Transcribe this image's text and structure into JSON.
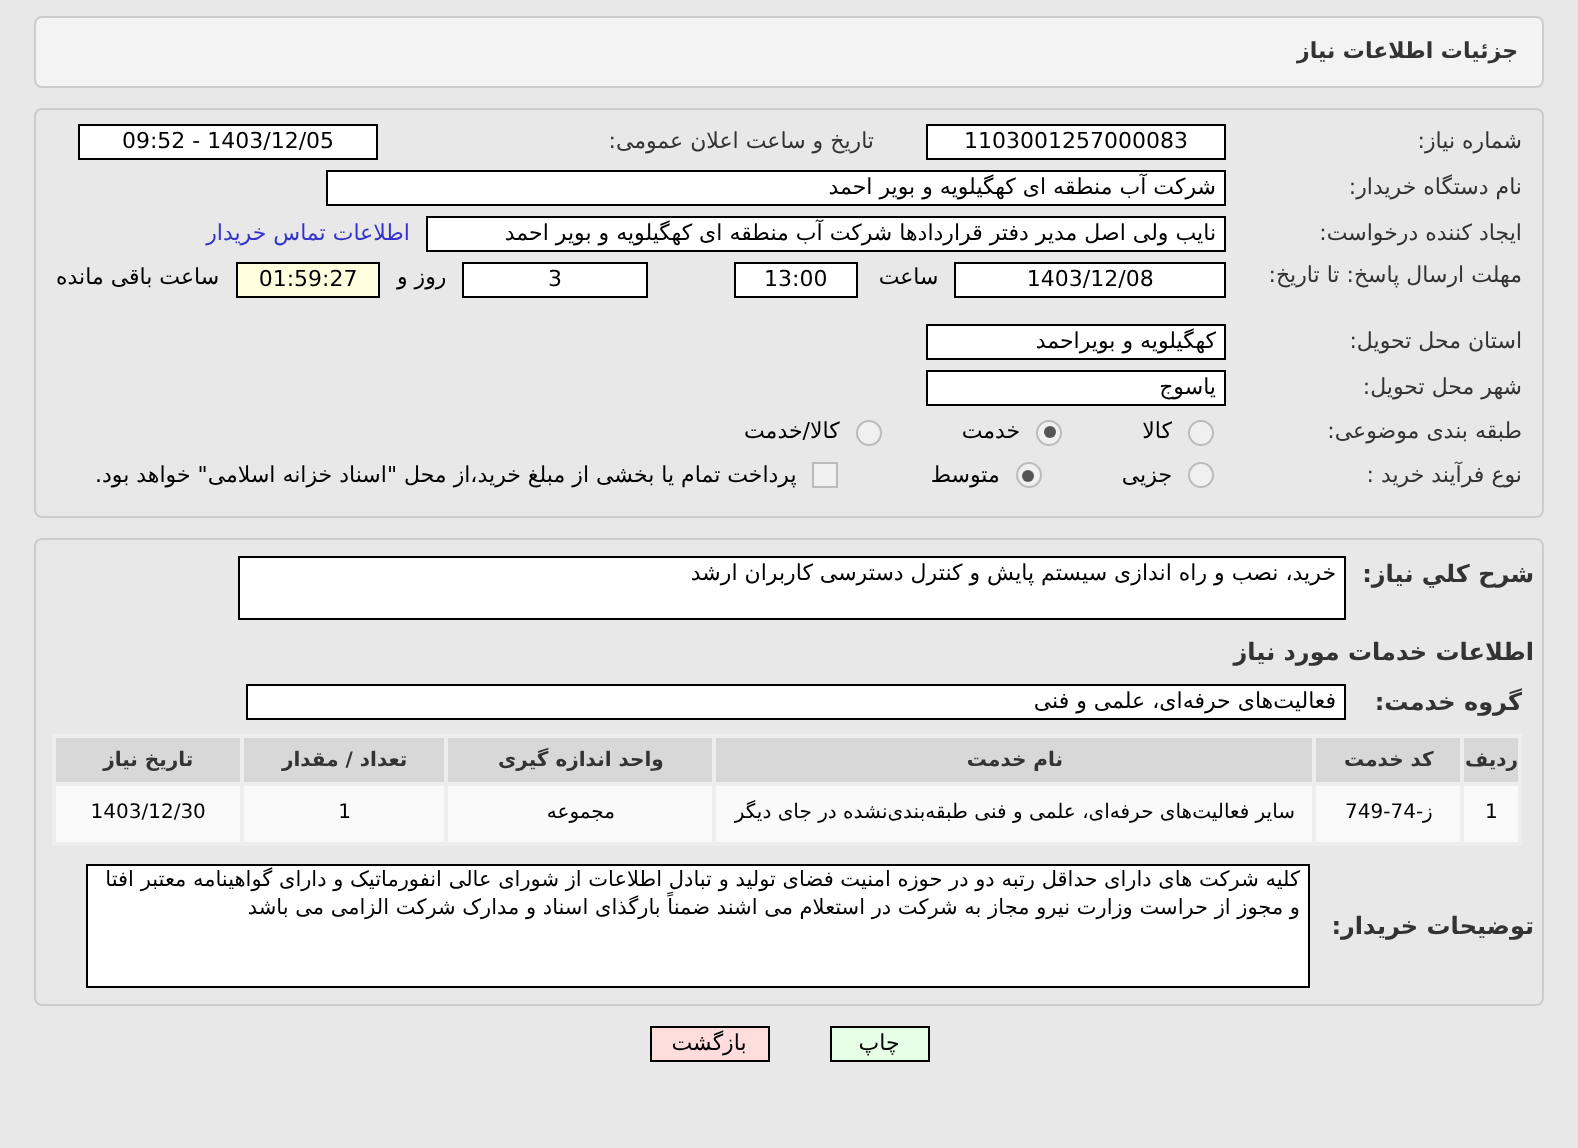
{
  "header": {
    "title": "جزئیات اطلاعات نیاز"
  },
  "need_number": {
    "label": "شماره نیاز:",
    "value": "1103001257000083"
  },
  "announce": {
    "label": "تاریخ و ساعت اعلان عمومی:",
    "value": "1403/12/05 - 09:52"
  },
  "buyer": {
    "label": "نام دستگاه خریدار:",
    "value": "شرکت آب منطقه ای کهگیلویه و بویر احمد"
  },
  "creator": {
    "label": "ایجاد کننده درخواست:",
    "value": "نایب ولی اصل مدیر دفتر قراردادها شرکت آب منطقه ای کهگیلویه و بویر احمد",
    "link": "اطلاعات تماس خریدار"
  },
  "deadline": {
    "label": "مهلت ارسال پاسخ: تا تاریخ:",
    "date": "1403/12/08",
    "time_label": "ساعت",
    "time": "13:00",
    "days": "3",
    "days_label": "روز و",
    "remaining": "01:59:27",
    "remaining_label": "ساعت باقی مانده"
  },
  "province": {
    "label": "استان محل تحویل:",
    "value": "کهگیلویه و بویراحمد"
  },
  "city": {
    "label": "شهر محل تحویل:",
    "value": "یاسوج"
  },
  "category": {
    "label": "طبقه بندی موضوعی:",
    "options": [
      {
        "label": "کالا",
        "selected": false
      },
      {
        "label": "خدمت",
        "selected": true
      },
      {
        "label": "کالا/خدمت",
        "selected": false
      }
    ]
  },
  "process": {
    "label": "نوع فرآیند خرید :",
    "options": [
      {
        "label": "جزیی",
        "selected": false
      },
      {
        "label": "متوسط",
        "selected": true
      }
    ],
    "treasury": {
      "checked": false,
      "label": "پرداخت تمام یا بخشی از مبلغ خرید،از محل \"اسناد خزانه اسلامی\" خواهد بود."
    }
  },
  "summary": {
    "label": "شرح كلي نياز:",
    "value": "خرید، نصب و راه اندازی سیستم پایش و کنترل دسترسی کاربران ارشد"
  },
  "services_title": "اطلاعات خدمات مورد نیاز",
  "service_group": {
    "label": "گروه خدمت:",
    "value": "فعالیت‌های حرفه‌ای، علمی و فنی"
  },
  "table": {
    "columns": [
      "ردیف",
      "کد خدمت",
      "نام خدمت",
      "واحد اندازه گیری",
      "تعداد / مقدار",
      "تاریخ نیاز"
    ],
    "rows": [
      [
        "1",
        "ز-74-749",
        "سایر فعالیت‌های حرفه‌ای، علمی و فنی طبقه‌بندی‌نشده در جای دیگر",
        "مجموعه",
        "1",
        "1403/12/30"
      ]
    ]
  },
  "buyer_notes": {
    "label": "توضیحات خریدار:",
    "value": "کلیه شرکت های دارای حداقل رتبه دو در حوزه امنیت فضای تولید و تبادل اطلاعات از شورای عالی انفورماتیک و دارای گواهینامه معتبر افتا و مجوز از حراست وزارت نیرو مجاز به شرکت در استعلام می اشند ضمناً بارگذای اسناد و مدارک شرکت الزامی می باشد"
  },
  "buttons": [
    {
      "kind": "print",
      "label": "چاپ"
    },
    {
      "kind": "back",
      "label": "بازگشت"
    }
  ]
}
